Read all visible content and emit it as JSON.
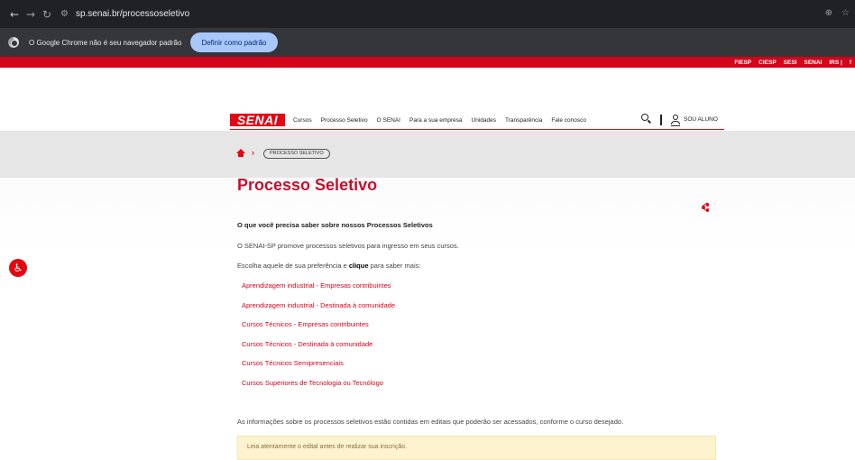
{
  "browser": {
    "url": "sp.senai.br/processoseletivo",
    "icons": {
      "back": "arrow-left-icon",
      "forward": "arrow-right-icon",
      "reload": "reload-icon",
      "site_info": "tune-icon",
      "zoom": "zoom-icon",
      "star": "bookmark-star-icon"
    },
    "infobar_text": "O Google Chrome não é seu navegador padrão",
    "default_button": "Definir como padrão"
  },
  "topbar": {
    "links": [
      "FIESP",
      "CIESP",
      "SESI",
      "SENAI",
      "IRS |"
    ],
    "facebook": "f"
  },
  "header": {
    "logo": "SENAI",
    "nav": [
      "Cursos",
      "Processo Seletivo",
      "O SENAI",
      "Para a sua empresa",
      "Unidades",
      "Transparência",
      "Fale conosco"
    ],
    "sou_aluno": "SOU ALUNO"
  },
  "breadcrumb": {
    "current": "PROCESSO SELETIVO"
  },
  "main": {
    "title": "Processo Seletivo",
    "subtitle": "O que você precisa saber sobre nossos Processos Seletivos",
    "intro": "O SENAI-SP promove processos seletivos para ingresso em seus cursos.",
    "choose_pre": "Escolha aquele de sua preferência e ",
    "choose_bold": "clique",
    "choose_post": " para saber mais:",
    "links": [
      "Aprendizagem industrial - Empresas contribuintes",
      "Aprendizagem industrial - Destinada à comunidade",
      "Cursos Técnicos - Empresas contribuintes",
      "Cursos Técnicos - Destinada à comunidade",
      "Cursos Técnicos Semipresenciais",
      "Cursos Superiores de Tecnologia ou Tecnólogo"
    ],
    "info": "As informações sobre os processos seletivos estão contidas em editais que poderão ser acessados, conforme o curso desejado.",
    "notice": "Leia atentamente o edital antes de realizar sua inscrição."
  },
  "colors": {
    "brand_red": "#e30613",
    "title_red": "#c8102e",
    "notice_bg": "#fdf4cf"
  }
}
